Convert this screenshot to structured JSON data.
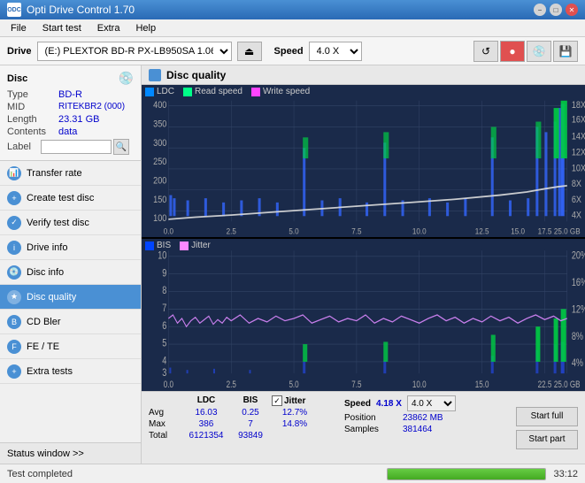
{
  "titlebar": {
    "app_name": "Opti Drive Control 1.70",
    "icon": "ODC",
    "btn_min": "−",
    "btn_max": "□",
    "btn_close": "✕"
  },
  "menubar": {
    "items": [
      "File",
      "Start test",
      "Extra",
      "Help"
    ]
  },
  "drivebar": {
    "label": "Drive",
    "drive_name": "(E:)  PLEXTOR BD-R  PX-LB950SA 1.06",
    "speed_label": "Speed",
    "speed_value": "4.0 X"
  },
  "disc": {
    "title": "Disc",
    "type_label": "Type",
    "type_value": "BD-R",
    "mid_label": "MID",
    "mid_value": "RITEKBR2 (000)",
    "length_label": "Length",
    "length_value": "23.31 GB",
    "contents_label": "Contents",
    "contents_value": "data",
    "label_label": "Label"
  },
  "nav": {
    "items": [
      {
        "id": "transfer-rate",
        "label": "Transfer rate",
        "active": false
      },
      {
        "id": "create-test-disc",
        "label": "Create test disc",
        "active": false
      },
      {
        "id": "verify-test-disc",
        "label": "Verify test disc",
        "active": false
      },
      {
        "id": "drive-info",
        "label": "Drive info",
        "active": false
      },
      {
        "id": "disc-info",
        "label": "Disc info",
        "active": false
      },
      {
        "id": "disc-quality",
        "label": "Disc quality",
        "active": true
      },
      {
        "id": "cd-bler",
        "label": "CD Bler",
        "active": false
      },
      {
        "id": "fe-te",
        "label": "FE / TE",
        "active": false
      },
      {
        "id": "extra-tests",
        "label": "Extra tests",
        "active": false
      }
    ]
  },
  "sidebar_status": {
    "label": "Status window >>"
  },
  "chart": {
    "title": "Disc quality",
    "legend_upper": {
      "ldc_label": "LDC",
      "read_label": "Read speed",
      "write_label": "Write speed"
    },
    "legend_lower": {
      "bis_label": "BIS",
      "jitter_label": "Jitter"
    },
    "upper_y_left_max": 400,
    "upper_y_right_max": 18,
    "lower_y_left_max": 10,
    "lower_y_right_max": 20
  },
  "stats": {
    "ldc_label": "LDC",
    "bis_label": "BIS",
    "jitter_label": "Jitter",
    "jitter_checked": true,
    "speed_label": "Speed",
    "speed_value": "4.18 X",
    "speed_select": "4.0 X",
    "avg_label": "Avg",
    "ldc_avg": "16.03",
    "bis_avg": "0.25",
    "jitter_avg": "12.7%",
    "max_label": "Max",
    "ldc_max": "386",
    "bis_max": "7",
    "jitter_max": "14.8%",
    "total_label": "Total",
    "ldc_total": "6121354",
    "bis_total": "93849",
    "position_label": "Position",
    "position_value": "23862 MB",
    "samples_label": "Samples",
    "samples_value": "381464",
    "btn_start_full": "Start full",
    "btn_start_part": "Start part"
  },
  "bottombar": {
    "status_text": "Test completed",
    "progress_pct": 100,
    "time_text": "33:12"
  }
}
